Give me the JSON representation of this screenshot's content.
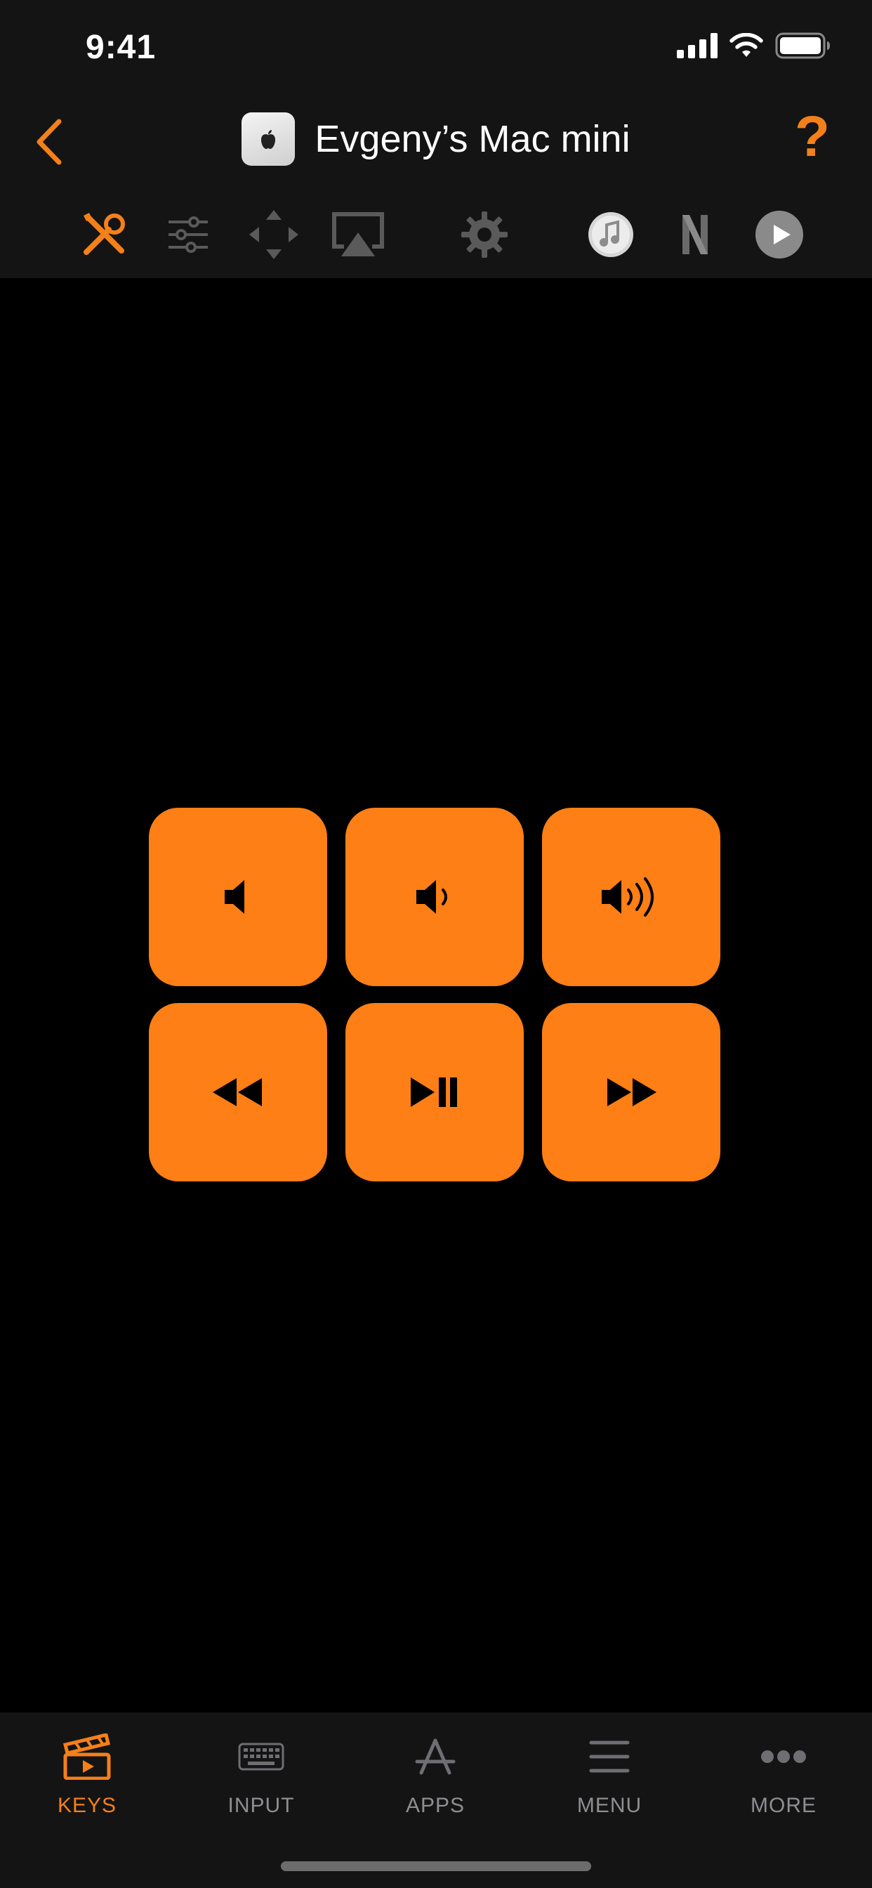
{
  "status_bar": {
    "time": "9:41"
  },
  "nav": {
    "title": "Evgeny’s Mac mini",
    "help_label": "?"
  },
  "toolbar": {
    "items": [
      {
        "name": "tools-icon",
        "active": true
      },
      {
        "name": "sliders-icon",
        "active": false
      },
      {
        "name": "dpad-icon",
        "active": false
      },
      {
        "name": "airplay-icon",
        "active": false
      },
      {
        "name": "gear-icon",
        "active": false
      },
      {
        "name": "itunes-icon",
        "active": false
      },
      {
        "name": "netflix-icon",
        "active": false
      },
      {
        "name": "play-circle-icon",
        "active": false
      }
    ]
  },
  "keys": [
    {
      "name": "volume-mute-icon"
    },
    {
      "name": "volume-low-icon"
    },
    {
      "name": "volume-high-icon"
    },
    {
      "name": "rewind-icon"
    },
    {
      "name": "play-pause-icon"
    },
    {
      "name": "fast-forward-icon"
    }
  ],
  "tabs": [
    {
      "label": "KEYS",
      "icon": "clapperboard-icon",
      "active": true
    },
    {
      "label": "INPUT",
      "icon": "keyboard-icon",
      "active": false
    },
    {
      "label": "APPS",
      "icon": "appstore-icon",
      "active": false
    },
    {
      "label": "MENU",
      "icon": "menu-icon",
      "active": false
    },
    {
      "label": "MORE",
      "icon": "more-icon",
      "active": false
    }
  ],
  "colors": {
    "accent": "#f4801a",
    "key_bg": "#fd7f15",
    "bar_bg": "#141414",
    "inactive": "#8e8e93"
  }
}
